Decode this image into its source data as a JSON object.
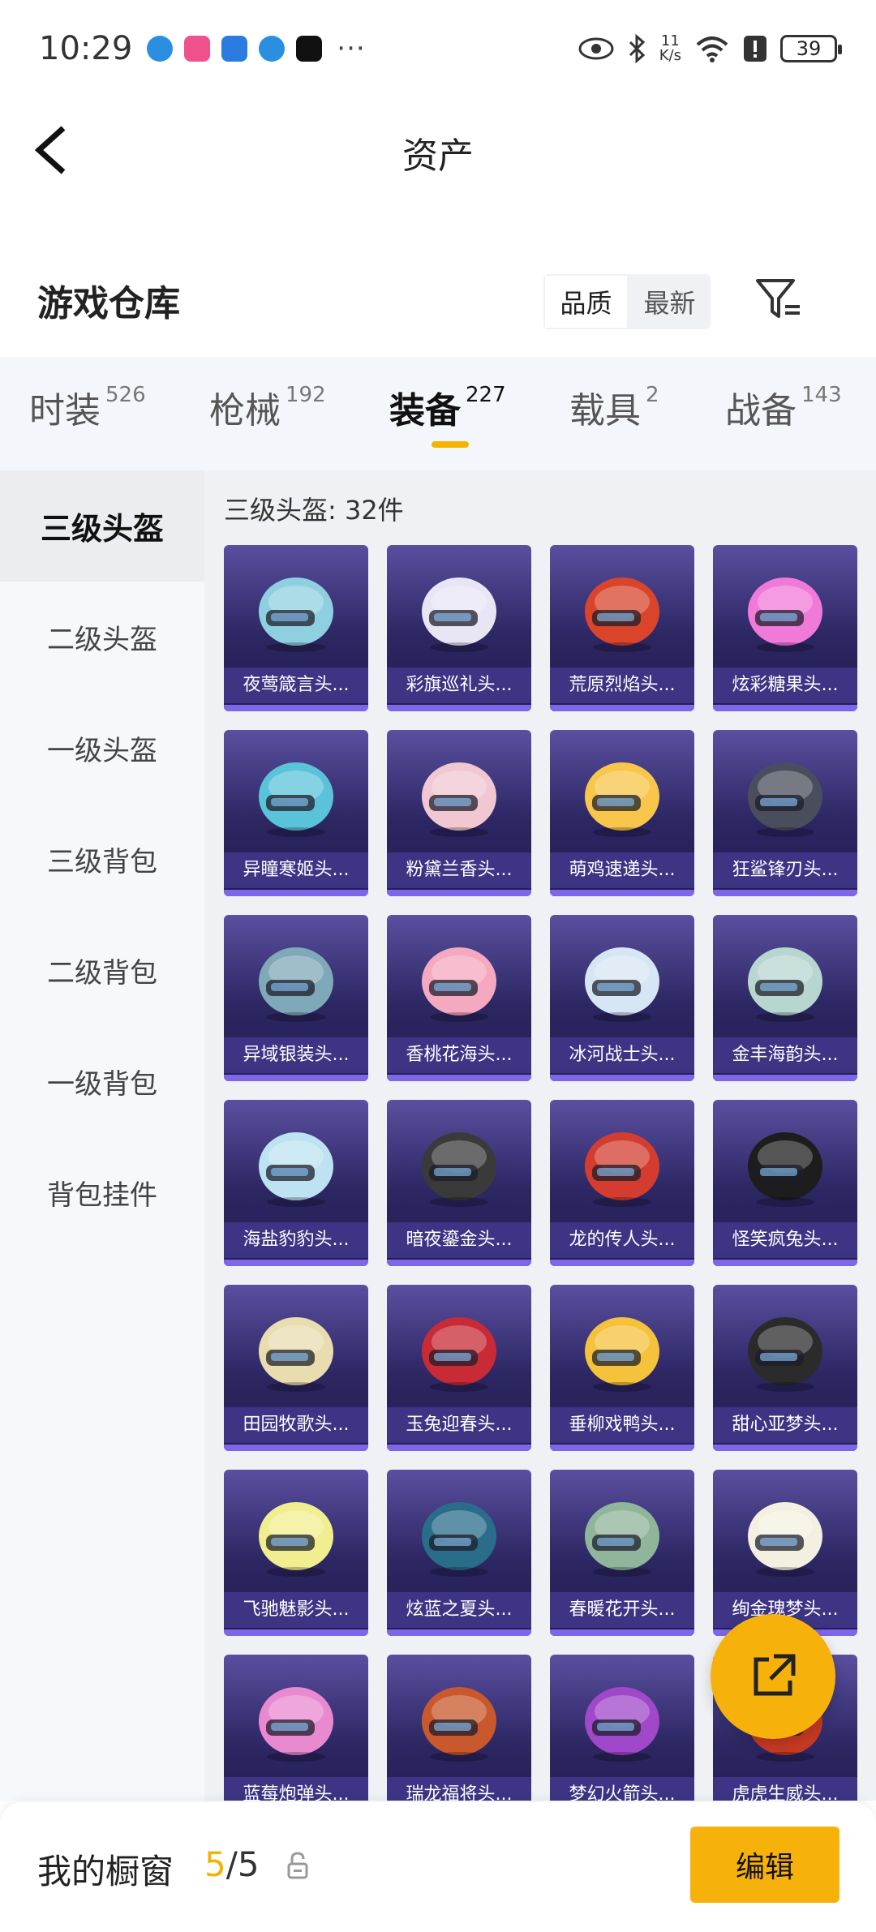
{
  "status_bar": {
    "time": "10:29",
    "net_speed_top": "11",
    "net_speed_bottom": "K/s",
    "battery": "39"
  },
  "header": {
    "title": "资产"
  },
  "section": {
    "title": "游戏仓库",
    "sort_options": [
      "品质",
      "最新"
    ]
  },
  "categories": [
    {
      "label": "时装",
      "count": "526"
    },
    {
      "label": "枪械",
      "count": "192"
    },
    {
      "label": "装备",
      "count": "227"
    },
    {
      "label": "载具",
      "count": "2"
    },
    {
      "label": "战备",
      "count": "143"
    }
  ],
  "subcategories": [
    "三级头盔",
    "二级头盔",
    "一级头盔",
    "三级背包",
    "二级背包",
    "一级背包",
    "背包挂件"
  ],
  "content": {
    "count_text": "三级头盔: 32件",
    "items": [
      {
        "name": "夜莺箴言头...",
        "color": "#8fd0e0"
      },
      {
        "name": "彩旗巡礼头...",
        "color": "#e8e6f5"
      },
      {
        "name": "荒原烈焰头...",
        "color": "#d9442b"
      },
      {
        "name": "炫彩糖果头...",
        "color": "#f07ad8"
      },
      {
        "name": "异瞳寒姬头...",
        "color": "#5bc3d9"
      },
      {
        "name": "粉黛兰香头...",
        "color": "#f1c7d2"
      },
      {
        "name": "萌鸡速递头...",
        "color": "#f7c64a"
      },
      {
        "name": "狂鲨锋刃头...",
        "color": "#4a4e5c"
      },
      {
        "name": "异域银装头...",
        "color": "#7fa8b8"
      },
      {
        "name": "香桃花海头...",
        "color": "#f4a9c0"
      },
      {
        "name": "冰河战士头...",
        "color": "#d7e6f5"
      },
      {
        "name": "金丰海韵头...",
        "color": "#b8d6d0"
      },
      {
        "name": "海盐豹豹头...",
        "color": "#bde3f2"
      },
      {
        "name": "暗夜鎏金头...",
        "color": "#3a3a3a"
      },
      {
        "name": "龙的传人头...",
        "color": "#d33c2f"
      },
      {
        "name": "怪笑疯兔头...",
        "color": "#1d1d1d"
      },
      {
        "name": "田园牧歌头...",
        "color": "#e9ddb0"
      },
      {
        "name": "玉兔迎春头...",
        "color": "#c92b36"
      },
      {
        "name": "垂柳戏鸭头...",
        "color": "#f5c23c"
      },
      {
        "name": "甜心亚梦头...",
        "color": "#2b2b2b"
      },
      {
        "name": "飞驰魅影头...",
        "color": "#f0ee8f"
      },
      {
        "name": "炫蓝之夏头...",
        "color": "#2a6d8a"
      },
      {
        "name": "春暖花开头...",
        "color": "#8fb59a"
      },
      {
        "name": "绚金瑰梦头...",
        "color": "#f4f0e1"
      },
      {
        "name": "蓝莓炮弹头...",
        "color": "#e989d0"
      },
      {
        "name": "瑞龙福将头...",
        "color": "#c9582c"
      },
      {
        "name": "梦幻火箭头...",
        "color": "#9f48c9"
      },
      {
        "name": "虎虎生威头...",
        "color": "#c73a23"
      }
    ]
  },
  "bottom": {
    "showcase_label": "我的橱窗",
    "used": "5",
    "total": "/5",
    "edit_label": "编辑"
  },
  "colors": {
    "accent": "#f6b20a",
    "card_dark": "#2c2662",
    "card_bar": "#7d66e8"
  }
}
